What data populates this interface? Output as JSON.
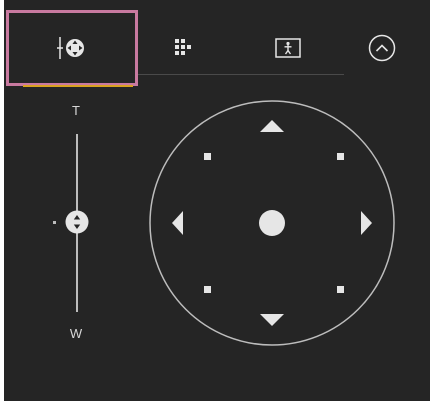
{
  "tabs": [
    {
      "name": "pan-tilt-zoom",
      "icon": "ptz-control-icon",
      "selected": true
    },
    {
      "name": "preset-grid",
      "icon": "grid-menu-icon",
      "selected": false
    },
    {
      "name": "image-frame",
      "icon": "frame-person-icon",
      "selected": false
    }
  ],
  "collapse_icon": "chevron-up-circle-icon",
  "zoom": {
    "tele_label": "T",
    "wide_label": "W"
  },
  "colors": {
    "panel_bg": "#252525",
    "selected_border": "#c97aa0",
    "tab_underline": "#d9a21f",
    "control_fg": "#e6e6e6"
  }
}
